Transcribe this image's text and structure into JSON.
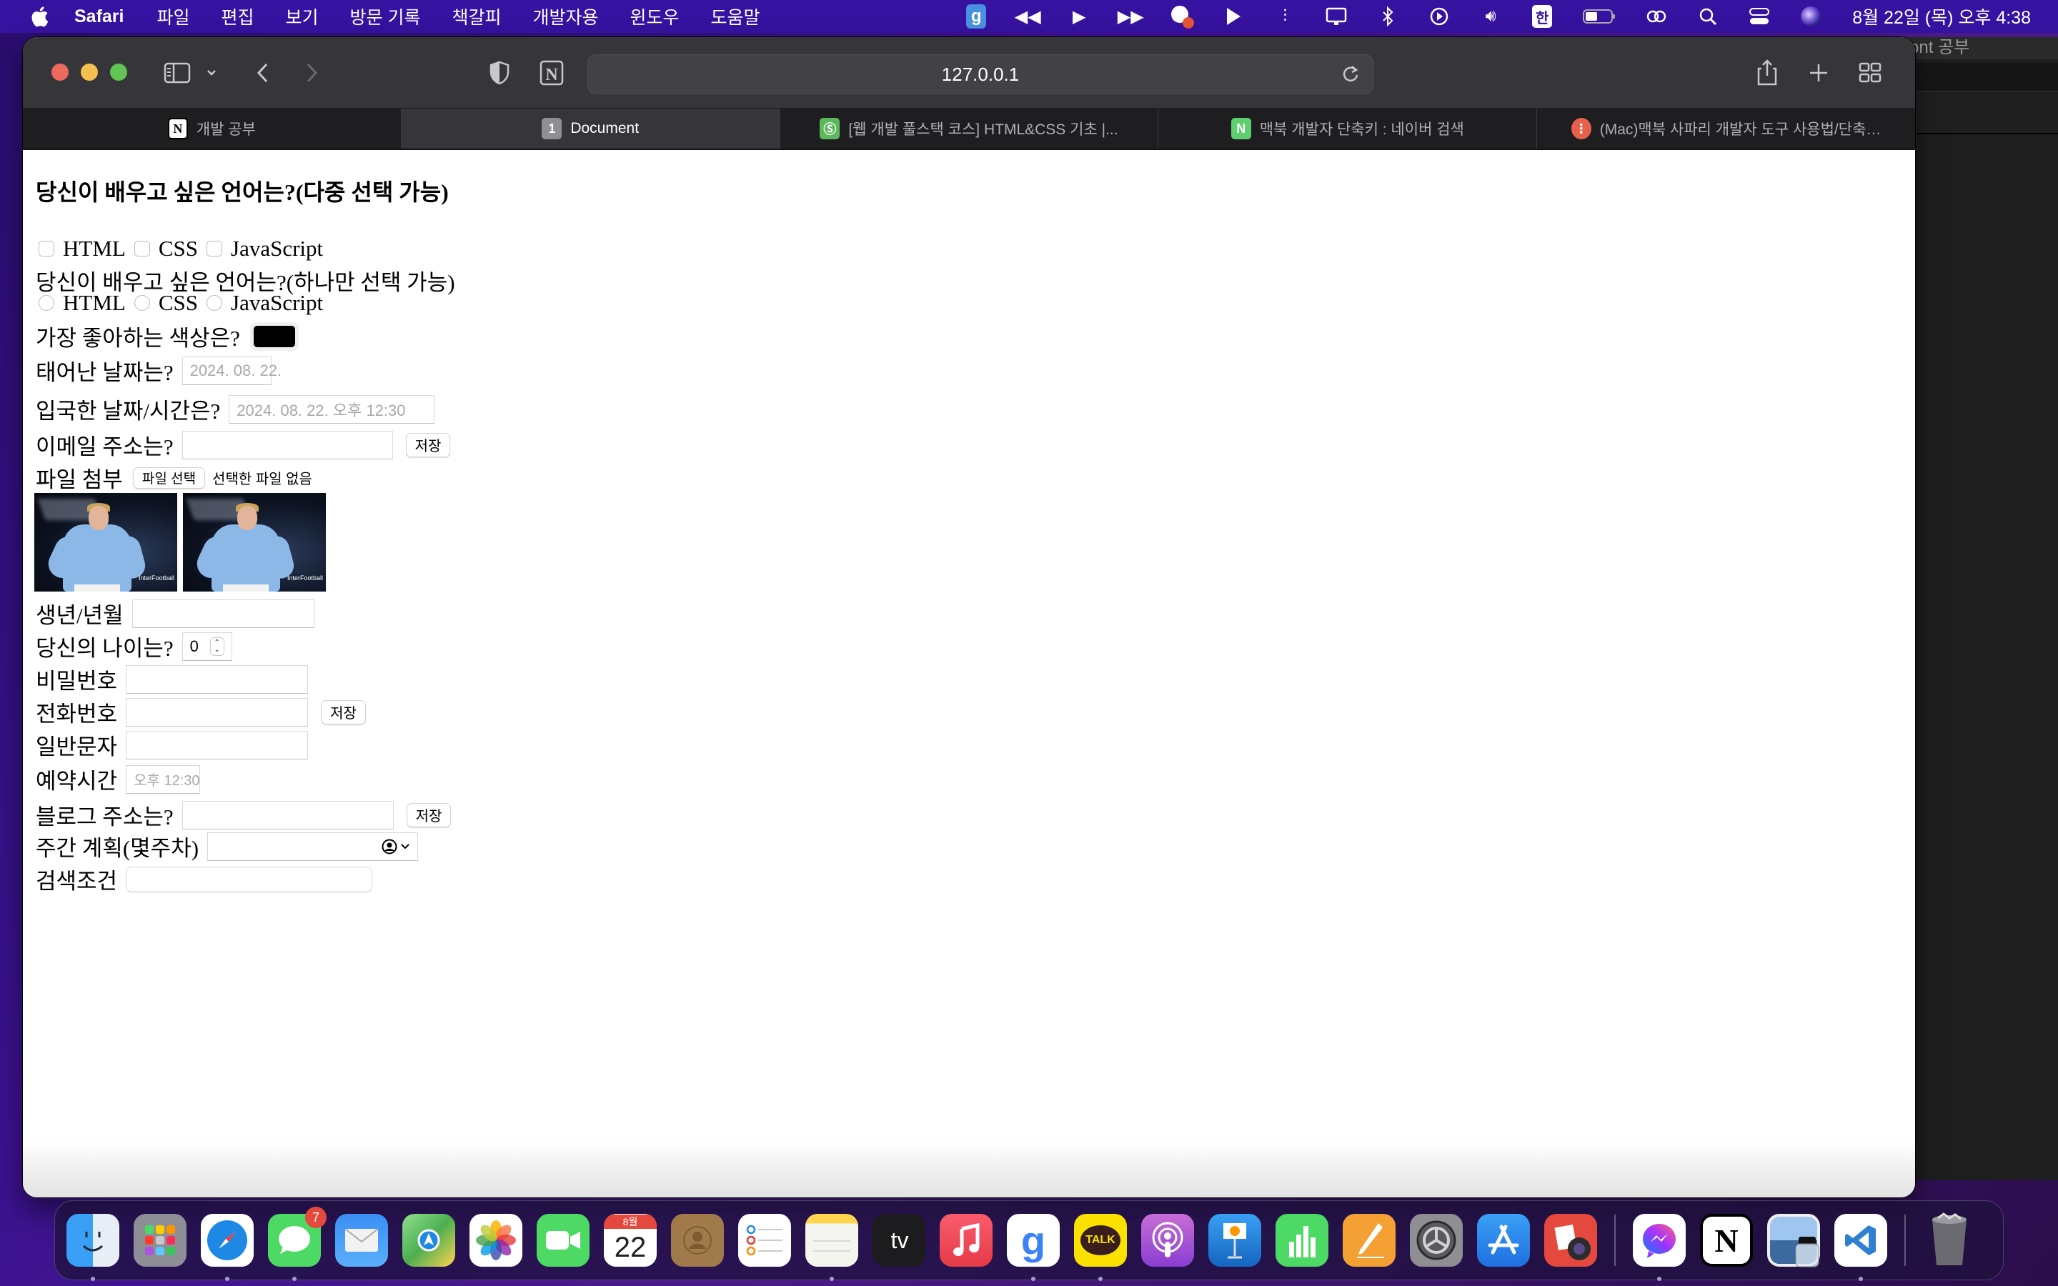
{
  "menubar": {
    "app_name": "Safari",
    "items": [
      "파일",
      "편집",
      "보기",
      "방문 기록",
      "책갈피",
      "개발자용",
      "윈도우",
      "도움말"
    ],
    "status_icons": [
      "grammarly-icon",
      "rewind-icon",
      "play-icon",
      "fast-forward-icon",
      "chat-notification-icon",
      "flag-icon",
      "sidecar-icon",
      "display-icon",
      "bluetooth-icon",
      "play-circle-icon",
      "volume-icon",
      "input-source-icon",
      "battery-icon",
      "link-icon",
      "spotlight-icon",
      "control-center-icon",
      "siri-icon"
    ],
    "input_source": "한",
    "clock": "8월 22일 (목) 오후 4:38"
  },
  "background_window": {
    "title_fragment": "ont 공부"
  },
  "browser": {
    "url": "127.0.0.1",
    "tabs": [
      {
        "label": "개발 공부",
        "favicon": "notion",
        "favicon_text": "N",
        "active": false
      },
      {
        "label": "Document",
        "favicon": "number",
        "favicon_text": "1",
        "active": true
      },
      {
        "label": "[웹 개발 풀스택 코스] HTML&CSS 기초 |...",
        "favicon": "green-logo",
        "favicon_text": "Ⓢ",
        "active": false
      },
      {
        "label": "맥북 개발자 단축키 : 네이버 검색",
        "favicon": "naver",
        "favicon_text": "N",
        "active": false
      },
      {
        "label": "(Mac)맥북 사파리 개발자 도구 사용법/단축…",
        "favicon": "red-dots",
        "favicon_text": "⋮",
        "active": false
      }
    ]
  },
  "page": {
    "heading": "당신이 배우고 싶은 언어는?(다중 선택 가능)",
    "checkbox_options": [
      "HTML",
      "CSS",
      "JavaScript"
    ],
    "radio_question": "당신이 배우고 싶은 언어는?(하나만 선택 가능)",
    "radio_options": [
      "HTML",
      "CSS",
      "JavaScript"
    ],
    "color_label": "가장 좋아하는 색상은?",
    "color_value": "#000000",
    "birthdate_label": "태어난 날짜는?",
    "birthdate_value": "2024. 08. 22.",
    "entry_label": "입국한 날짜/시간은?",
    "entry_value": "2024. 08. 22. 오후 12:30",
    "email_label": "이메일 주소는?",
    "email_value": "",
    "save_label": "저장",
    "file_label": "파일 첨부",
    "file_button": "파일 선택",
    "file_status": "선택한 파일 없음",
    "image_watermark": "InterFootball",
    "month_label": "생년/년월",
    "month_value": "",
    "age_label": "당신의 나이는?",
    "age_value": "0",
    "password_label": "비밀번호",
    "phone_label": "전화번호",
    "text_label": "일반문자",
    "time_label": "예약시간",
    "time_value": "오후 12:30",
    "blog_label": "블로그 주소는?",
    "week_label": "주간 계획(몇주차)",
    "search_label": "검색조건"
  },
  "dock": {
    "apps": [
      {
        "name": "Finder",
        "running": true
      },
      {
        "name": "Launchpad",
        "running": false
      },
      {
        "name": "Safari",
        "running": true
      },
      {
        "name": "Messages",
        "running": true,
        "badge": "7"
      },
      {
        "name": "Mail",
        "running": false
      },
      {
        "name": "Maps",
        "running": false
      },
      {
        "name": "Photos",
        "running": false
      },
      {
        "name": "FaceTime",
        "running": false
      },
      {
        "name": "Calendar",
        "running": false,
        "month": "8월",
        "day": "22"
      },
      {
        "name": "Contacts",
        "running": false
      },
      {
        "name": "Reminders",
        "running": false
      },
      {
        "name": "Notes",
        "running": true
      },
      {
        "name": "Apple TV",
        "running": false,
        "text": "tv"
      },
      {
        "name": "Music",
        "running": false
      },
      {
        "name": "Grammarly",
        "running": true,
        "text": "g"
      },
      {
        "name": "KakaoTalk",
        "running": true,
        "text": "TALK"
      },
      {
        "name": "Podcasts",
        "running": false
      },
      {
        "name": "Keynote",
        "running": false
      },
      {
        "name": "Numbers",
        "running": false
      },
      {
        "name": "Pages",
        "running": false
      },
      {
        "name": "System Preferences",
        "running": false
      },
      {
        "name": "App Store",
        "running": false
      },
      {
        "name": "Photo Booth",
        "running": false
      }
    ],
    "recent_apps": [
      {
        "name": "Messenger",
        "running": true
      },
      {
        "name": "Notion",
        "running": false,
        "text": "N"
      },
      {
        "name": "Preview",
        "running": false
      },
      {
        "name": "Visual Studio Code",
        "running": true
      }
    ],
    "trash": {
      "name": "Trash"
    }
  }
}
